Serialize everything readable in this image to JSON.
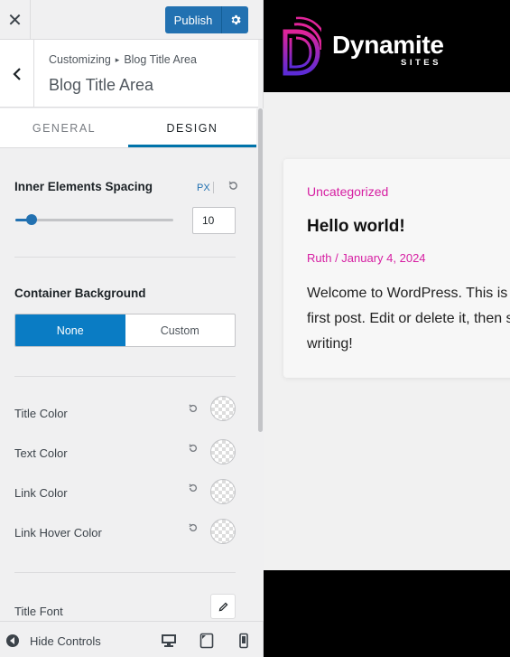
{
  "topbar": {
    "close_glyph": "✕",
    "publish_label": "Publish",
    "gear_icon": "gear-icon"
  },
  "section": {
    "breadcrumb_root": "Customizing",
    "breadcrumb_leaf": "Blog Title Area",
    "title": "Blog Title Area"
  },
  "tabs": [
    {
      "label": "GENERAL",
      "active": false
    },
    {
      "label": "DESIGN",
      "active": true
    }
  ],
  "spacing": {
    "label": "Inner Elements Spacing",
    "unit": "PX",
    "value": "10",
    "slider_fraction": 0.1
  },
  "background": {
    "label": "Container Background",
    "options": [
      "None",
      "Custom"
    ],
    "selected": "None"
  },
  "colors": [
    {
      "label": "Title Color"
    },
    {
      "label": "Text Color"
    },
    {
      "label": "Link Color"
    },
    {
      "label": "Link Hover Color"
    }
  ],
  "title_font": {
    "label": "Title Font"
  },
  "footer": {
    "hide_label": "Hide Controls"
  },
  "preview": {
    "logo_name": "Dynamite",
    "logo_sub": "SITES",
    "post": {
      "category": "Uncategorized",
      "title": "Hello world!",
      "meta": "Ruth / January 4, 2024",
      "excerpt_lines": [
        "Welcome to WordPress. This is your",
        "first post. Edit or delete it, then start",
        "writing!"
      ]
    },
    "accent_color": "#d61ea2"
  },
  "colors_theme": {
    "primary": "#2271b1",
    "segment_active": "#0a7cc4"
  }
}
